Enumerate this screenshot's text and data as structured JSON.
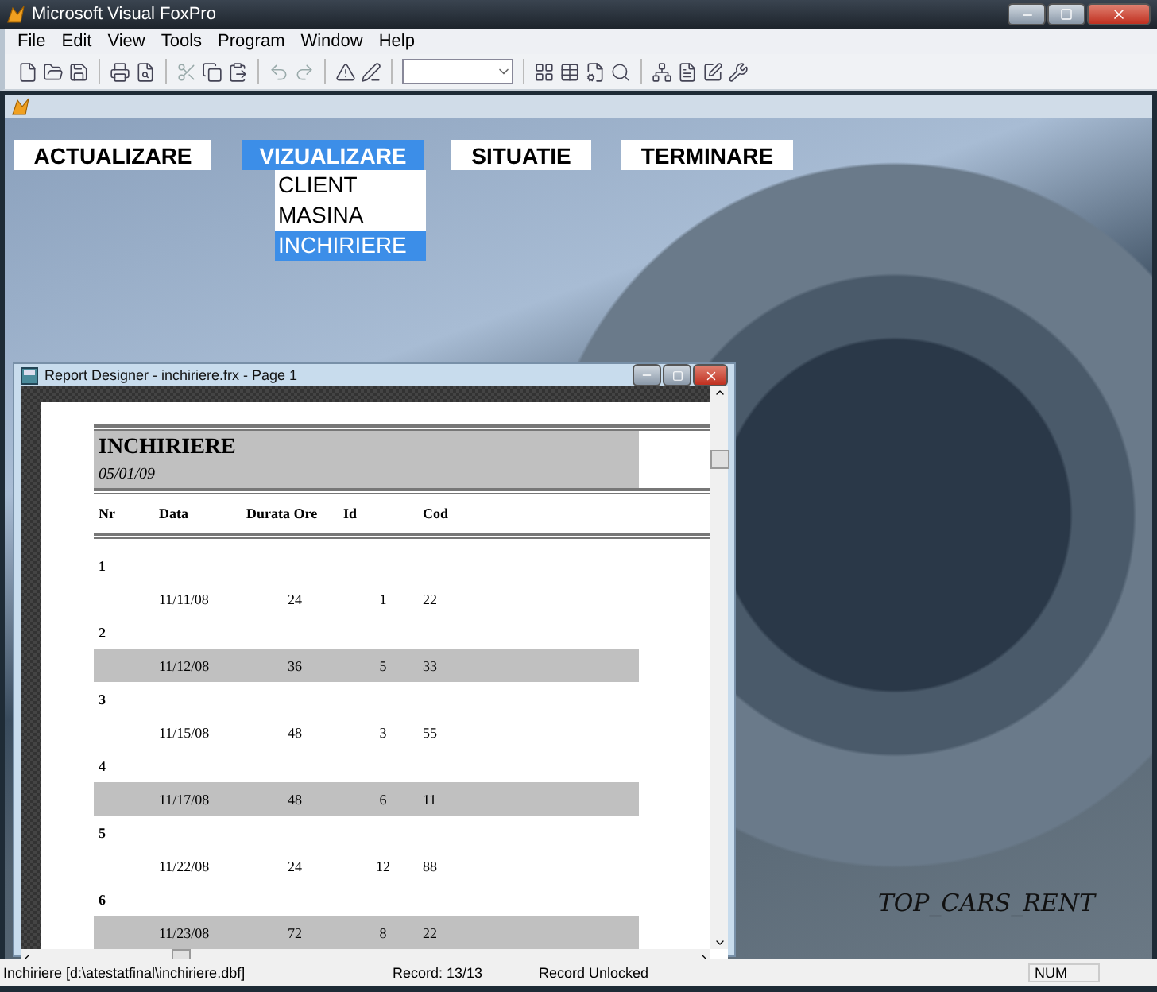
{
  "window": {
    "title": "Microsoft Visual FoxPro"
  },
  "menu": [
    "File",
    "Edit",
    "View",
    "Tools",
    "Program",
    "Window",
    "Help"
  ],
  "app_menu": [
    {
      "label": "ACTUALIZARE",
      "selected": false
    },
    {
      "label": "VIZUALIZARE",
      "selected": true
    },
    {
      "label": "SITUATIE",
      "selected": false
    },
    {
      "label": "TERMINARE",
      "selected": false
    }
  ],
  "dropdown": [
    {
      "label": "CLIENT",
      "selected": false
    },
    {
      "label": "MASINA",
      "selected": false
    },
    {
      "label": "INCHIRIERE",
      "selected": true
    }
  ],
  "report_window": {
    "title": "Report Designer - inchiriere.frx - Page 1",
    "report_title": "INCHIRIERE",
    "date": "05/01/09",
    "columns": [
      "Nr",
      "Data",
      "Durata Ore",
      "Id",
      "Cod"
    ],
    "records": [
      {
        "nr": "1",
        "data": "11/11/08",
        "durata": "24",
        "id": "1",
        "cod": "22",
        "shaded": false
      },
      {
        "nr": "2",
        "data": "11/12/08",
        "durata": "36",
        "id": "5",
        "cod": "33",
        "shaded": true
      },
      {
        "nr": "3",
        "data": "11/15/08",
        "durata": "48",
        "id": "3",
        "cod": "55",
        "shaded": false
      },
      {
        "nr": "4",
        "data": "11/17/08",
        "durata": "48",
        "id": "6",
        "cod": "11",
        "shaded": true
      },
      {
        "nr": "5",
        "data": "11/22/08",
        "durata": "24",
        "id": "12",
        "cod": "88",
        "shaded": false
      },
      {
        "nr": "6",
        "data": "11/23/08",
        "durata": "72",
        "id": "8",
        "cod": "22",
        "shaded": true
      }
    ]
  },
  "brand": "TOP_CARS_RENT",
  "status_bar": {
    "file": "Inchiriere [d:\\atestatfinal\\inchiriere.dbf]",
    "record": "Record: 13/13",
    "lock": "Record Unlocked",
    "num": "NUM"
  }
}
